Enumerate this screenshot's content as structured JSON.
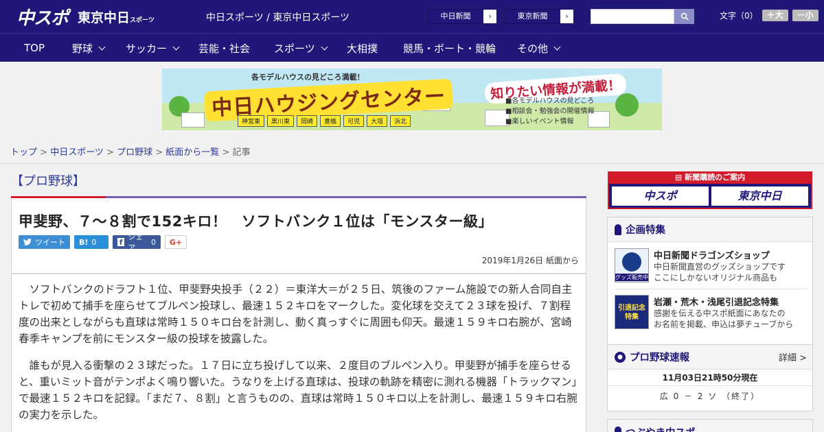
{
  "header": {
    "logo_main": "中スポ",
    "logo_sub": "東京中日",
    "logo_sub_small": "スポーツ",
    "tagline": "中日スポーツ / 東京中日スポーツ",
    "paper_buttons": [
      {
        "label": "中日新聞",
        "arrow": "›"
      },
      {
        "label": "東京新聞",
        "arrow": "›"
      }
    ],
    "search_placeholder": "",
    "font_size_label": "文字（0）",
    "font_plus": "＋大",
    "font_minus": "－小"
  },
  "nav": [
    {
      "label": "TOP",
      "has_menu": false
    },
    {
      "label": "野球",
      "has_menu": true
    },
    {
      "label": "サッカー",
      "has_menu": true
    },
    {
      "label": "芸能・社会",
      "has_menu": false
    },
    {
      "label": "スポーツ",
      "has_menu": true
    },
    {
      "label": "大相撲",
      "has_menu": false
    },
    {
      "label": "競馬・ボート・競輪",
      "has_menu": false
    },
    {
      "label": "その他",
      "has_menu": true
    }
  ],
  "banner": {
    "top_line": "各モデルハウスの見どころ満載！",
    "title": "中日ハウジングセンター",
    "catch": "知りたい情報が満載！",
    "lines": [
      "■各モデルハウスの見どころ",
      "■相談会・勉強会の開催情報",
      "■楽しいイベント情報"
    ],
    "towns": [
      "神宮東",
      "黒川東",
      "岡崎",
      "豊橋",
      "可児",
      "大垣",
      "浜北"
    ]
  },
  "breadcrumb": {
    "items": [
      "トップ",
      "中日スポーツ",
      "プロ野球",
      "紙面から一覧"
    ],
    "current": "記事",
    "sep": " > "
  },
  "article": {
    "section": "【プロ野球】",
    "headline": "甲斐野、７～８割で152キロ！　ソフトバンク１位は「モンスター級」",
    "share": {
      "tweet": "ツイート",
      "hatena_label": "B!",
      "hatena_count": "0",
      "fb_label": "シェア",
      "fb_count": "0",
      "gplus": "G+"
    },
    "date": "2019年1月26日 紙面から",
    "paragraphs": [
      "ソフトバンクのドラフト１位、甲斐野央投手（２２）＝東洋大＝が２５日、筑後のファーム施設での新人合同自主トレで初めて捕手を座らせてブルペン投球し、最速１５２キロをマークした。変化球を交えて２３球を投げ、７割程度の出来としながらも直球は常時１５０キロ台を計測し、動く真っすぐに周囲も仰天。最速１５９キロ右腕が、宮崎春季キャンプを前にモンスター級の投球を披露した。",
      "誰もが見入る衝撃の２３球だった。１７日に立ち投げして以来、２度目のブルペン入り。甲斐野が捕手を座らせると、重いミット音がテンポよく鳴り響いた。うなりを上げる直球は、投球の軌跡を精密に測れる機器「トラックマン」で最速１５２キロを記録。「まだ７、８割」と言うものの、直球は常時１５０キロ以上を計測し、最速１５９キロ右腕の実力を示した。"
    ]
  },
  "sidebar": {
    "subscribe": {
      "top": "新聞購読のご案内",
      "logo1": "中スポ",
      "logo2": "東京中日"
    },
    "features": {
      "title": "企画特集",
      "items": [
        {
          "title": "中日新聞ドラゴンズショップ",
          "desc1": "中日新聞直営のグッズショップです",
          "desc2": "ここにしかないオリジナル商品も",
          "thumb_text": "グッズ販売中"
        },
        {
          "title": "岩瀬・荒木・浅尾引退記念特集",
          "desc1": "感謝を伝える中スポ紙面にあなたの",
          "desc2": "お名前を掲載、申込は夢チューブから",
          "thumb_text": "引退記念特集"
        }
      ]
    },
    "live": {
      "title": "プロ野球速報",
      "detail": "詳細 >",
      "time": "11月03日21時50分現在",
      "score": "広 0 － 2 ソ （終了）"
    },
    "next_title": "つぶやき中スポ"
  },
  "colors": {
    "navy": "#201778",
    "accent_red": "#d21a2a",
    "link": "#2a3a9a",
    "purple_rule": "#7a5cb0"
  }
}
